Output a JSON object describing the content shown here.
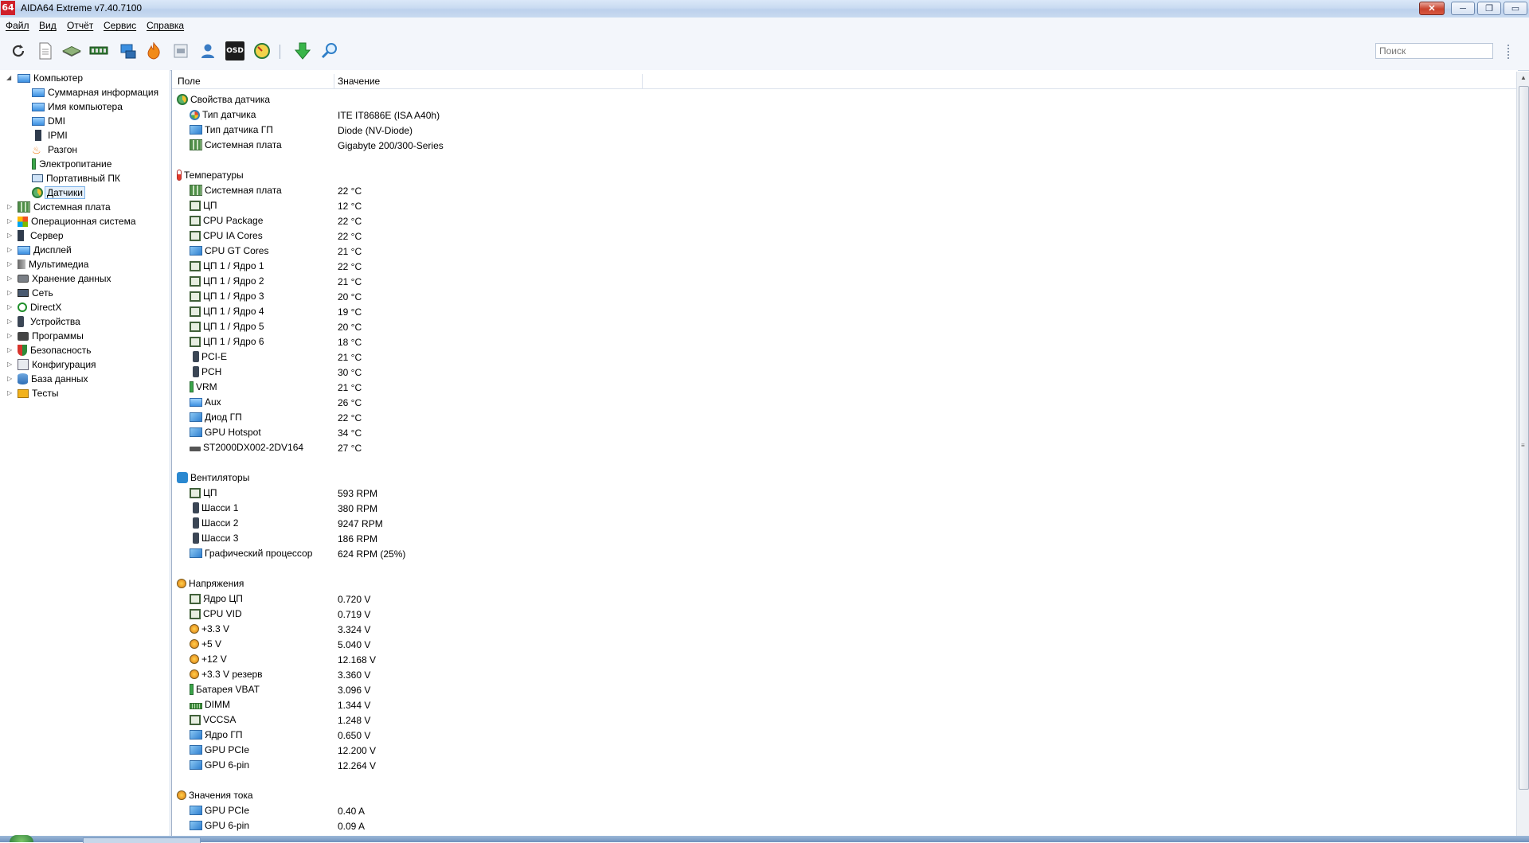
{
  "window": {
    "logo": "64",
    "title": "AIDA64 Extreme v7.40.7100",
    "buttons": {
      "close": "✕",
      "minimize": "─",
      "restore": "❐",
      "maximize": "▭"
    }
  },
  "menu": [
    "Файл",
    "Вид",
    "Отчёт",
    "Сервис",
    "Справка"
  ],
  "toolbar": {
    "icons": [
      "refresh-icon",
      "report-icon",
      "motherboard-icon",
      "memory-icon",
      "cpu-benchmark-icon",
      "overclock-icon",
      "bios-icon",
      "user-icon",
      "osd-icon",
      "sensor-gauge-icon",
      "download-icon",
      "search-icon"
    ],
    "osd_label": "OSD",
    "search_placeholder": "Поиск"
  },
  "tree": {
    "root": "Компьютер",
    "children": [
      "Суммарная информация",
      "Имя компьютера",
      "DMI",
      "IPMI",
      "Разгон",
      "Электропитание",
      "Портативный ПК",
      "Датчики"
    ],
    "selected": "Датчики",
    "nodes": [
      "Системная плата",
      "Операционная система",
      "Сервер",
      "Дисплей",
      "Мультимедиа",
      "Хранение данных",
      "Сеть",
      "DirectX",
      "Устройства",
      "Программы",
      "Безопасность",
      "Конфигурация",
      "База данных",
      "Тесты"
    ]
  },
  "table": {
    "columns": [
      "Поле",
      "Значение"
    ],
    "groups": [
      {
        "title": "Свойства датчика",
        "icon": "sensor",
        "rows": [
          {
            "field": "Тип датчика",
            "value": "ITE IT8686E  (ISA A40h)",
            "icon": "gauge"
          },
          {
            "field": "Тип датчика ГП",
            "value": "Diode  (NV-Diode)",
            "icon": "gpu"
          },
          {
            "field": "Системная плата",
            "value": "Gigabyte 200/300-Series",
            "icon": "mb"
          }
        ]
      },
      {
        "title": "Температуры",
        "icon": "therm",
        "rows": [
          {
            "field": "Системная плата",
            "value": "22 °C",
            "icon": "mb"
          },
          {
            "field": "ЦП",
            "value": "12 °C",
            "icon": "chip"
          },
          {
            "field": "CPU Package",
            "value": "22 °C",
            "icon": "chip"
          },
          {
            "field": "CPU IA Cores",
            "value": "22 °C",
            "icon": "chip"
          },
          {
            "field": "CPU GT Cores",
            "value": "21 °C",
            "icon": "gpu"
          },
          {
            "field": "ЦП 1 / Ядро 1",
            "value": "22 °C",
            "icon": "chip"
          },
          {
            "field": "ЦП 1 / Ядро 2",
            "value": "21 °C",
            "icon": "chip"
          },
          {
            "field": "ЦП 1 / Ядро 3",
            "value": "20 °C",
            "icon": "chip"
          },
          {
            "field": "ЦП 1 / Ядро 4",
            "value": "19 °C",
            "icon": "chip"
          },
          {
            "field": "ЦП 1 / Ядро 5",
            "value": "20 °C",
            "icon": "chip"
          },
          {
            "field": "ЦП 1 / Ядро 6",
            "value": "18 °C",
            "icon": "chip"
          },
          {
            "field": "PCI-E",
            "value": "21 °C",
            "icon": "dev"
          },
          {
            "field": "PCH",
            "value": "30 °C",
            "icon": "dev"
          },
          {
            "field": "VRM",
            "value": "21 °C",
            "icon": "bat"
          },
          {
            "field": "Aux",
            "value": "26 °C",
            "icon": "mon"
          },
          {
            "field": "Диод ГП",
            "value": "22 °C",
            "icon": "gpu"
          },
          {
            "field": "GPU Hotspot",
            "value": "34 °C",
            "icon": "gpu"
          },
          {
            "field": "ST2000DX002-2DV164",
            "value": "27 °C",
            "icon": "disk"
          }
        ]
      },
      {
        "title": "Вентиляторы",
        "icon": "fan",
        "rows": [
          {
            "field": "ЦП",
            "value": "593 RPM",
            "icon": "chip"
          },
          {
            "field": "Шасси 1",
            "value": "380 RPM",
            "icon": "dev"
          },
          {
            "field": "Шасси 2",
            "value": "9247 RPM",
            "icon": "dev"
          },
          {
            "field": "Шасси 3",
            "value": "186 RPM",
            "icon": "dev"
          },
          {
            "field": "Графический процессор",
            "value": "624 RPM  (25%)",
            "icon": "gpu"
          }
        ]
      },
      {
        "title": "Напряжения",
        "icon": "volt",
        "rows": [
          {
            "field": "Ядро ЦП",
            "value": "0.720 V",
            "icon": "chip"
          },
          {
            "field": "CPU VID",
            "value": "0.719 V",
            "icon": "chip"
          },
          {
            "field": "+3.3 V",
            "value": "3.324 V",
            "icon": "volt"
          },
          {
            "field": "+5 V",
            "value": "5.040 V",
            "icon": "volt"
          },
          {
            "field": "+12 V",
            "value": "12.168 V",
            "icon": "volt"
          },
          {
            "field": "+3.3 V резерв",
            "value": "3.360 V",
            "icon": "volt"
          },
          {
            "field": "Батарея VBAT",
            "value": "3.096 V",
            "icon": "bat"
          },
          {
            "field": "DIMM",
            "value": "1.344 V",
            "icon": "ram"
          },
          {
            "field": "VCCSA",
            "value": "1.248 V",
            "icon": "chip"
          },
          {
            "field": "Ядро ГП",
            "value": "0.650 V",
            "icon": "gpu"
          },
          {
            "field": "GPU PCIe",
            "value": "12.200 V",
            "icon": "gpu"
          },
          {
            "field": "GPU 6-pin",
            "value": "12.264 V",
            "icon": "gpu"
          }
        ]
      },
      {
        "title": "Значения тока",
        "icon": "volt",
        "rows": [
          {
            "field": "GPU PCIe",
            "value": "0.40 A",
            "icon": "gpu"
          },
          {
            "field": "GPU 6-pin",
            "value": "0.09 A",
            "icon": "gpu"
          }
        ]
      }
    ]
  }
}
